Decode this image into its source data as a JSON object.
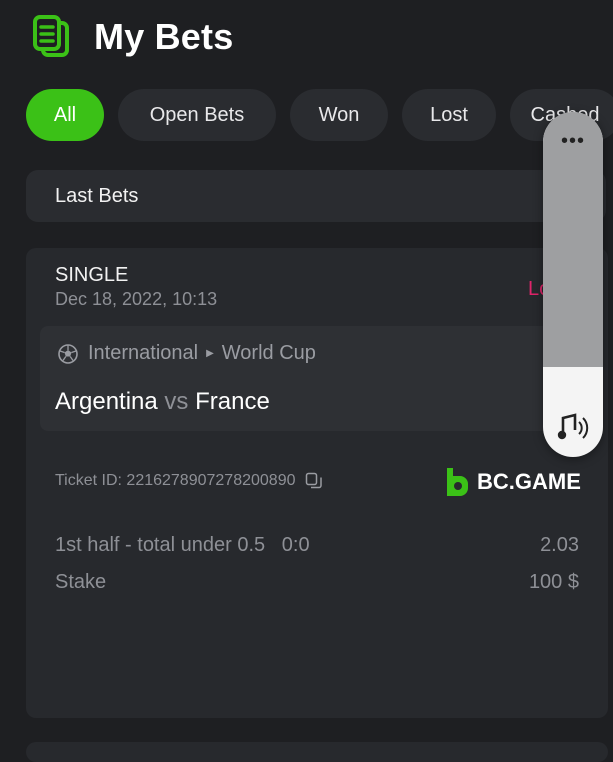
{
  "header": {
    "title": "My Bets"
  },
  "tabs": [
    {
      "label": "All",
      "active": true,
      "width": 78
    },
    {
      "label": "Open Bets",
      "active": false,
      "width": 158
    },
    {
      "label": "Won",
      "active": false,
      "width": 98
    },
    {
      "label": "Lost",
      "active": false,
      "width": 94
    },
    {
      "label": "Cashed",
      "active": false,
      "width": 110
    }
  ],
  "last_bets_label": "Last Bets",
  "bet": {
    "type": "SINGLE",
    "date": "Dec 18, 2022, 10:13",
    "status": "Lost",
    "category": "International",
    "tournament": "World Cup",
    "home": "Argentina",
    "vs": "vs",
    "away": "France",
    "ticket_label": "Ticket ID: 2216278907278200890",
    "brand": "BC.GAME",
    "selection": "1st half - total under 0.5   0:0",
    "odds": "2.03",
    "stake_label": "Stake",
    "stake_value": "100 $"
  },
  "volume_panel": {
    "more": "•••",
    "level_percent": 26
  },
  "colors": {
    "accent": "#3bc117",
    "lost": "#e0246a",
    "card": "#27292d",
    "background": "#1e1f22"
  },
  "icons": {
    "header": "bet-slip-icon",
    "league": "soccer-ball-icon",
    "copy": "copy-icon",
    "brand": "bc-game-logo",
    "sound": "sound-icon"
  }
}
